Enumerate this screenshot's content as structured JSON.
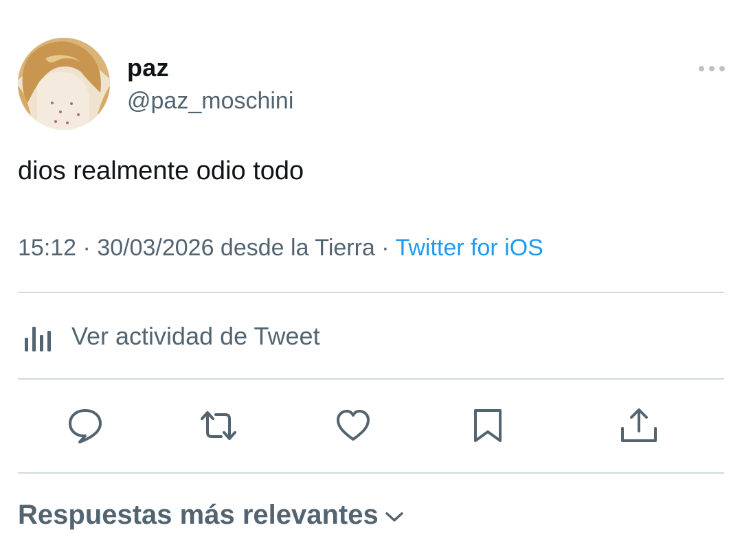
{
  "author": {
    "display_name": "paz",
    "handle": "@paz_moschini"
  },
  "tweet": {
    "text": "dios realmente odio todo",
    "time": "15:12",
    "separator_1": " · ",
    "date": "30/03/2026",
    "location": " desde la Tierra",
    "separator_2": " · ",
    "source": "Twitter for iOS"
  },
  "activity": {
    "label": "Ver actividad de Tweet",
    "icon": "analytics-bars-icon"
  },
  "actions": [
    {
      "icon": "reply-icon"
    },
    {
      "icon": "retweet-icon"
    },
    {
      "icon": "like-heart-icon"
    },
    {
      "icon": "bookmark-icon"
    },
    {
      "icon": "share-icon"
    }
  ],
  "replies_sort": {
    "label": "Respuestas más relevantes",
    "icon": "chevron-down-icon"
  },
  "colors": {
    "text_primary": "#0f1419",
    "text_secondary": "#536471",
    "link": "#1d9bf0",
    "divider": "#cfd9de"
  }
}
